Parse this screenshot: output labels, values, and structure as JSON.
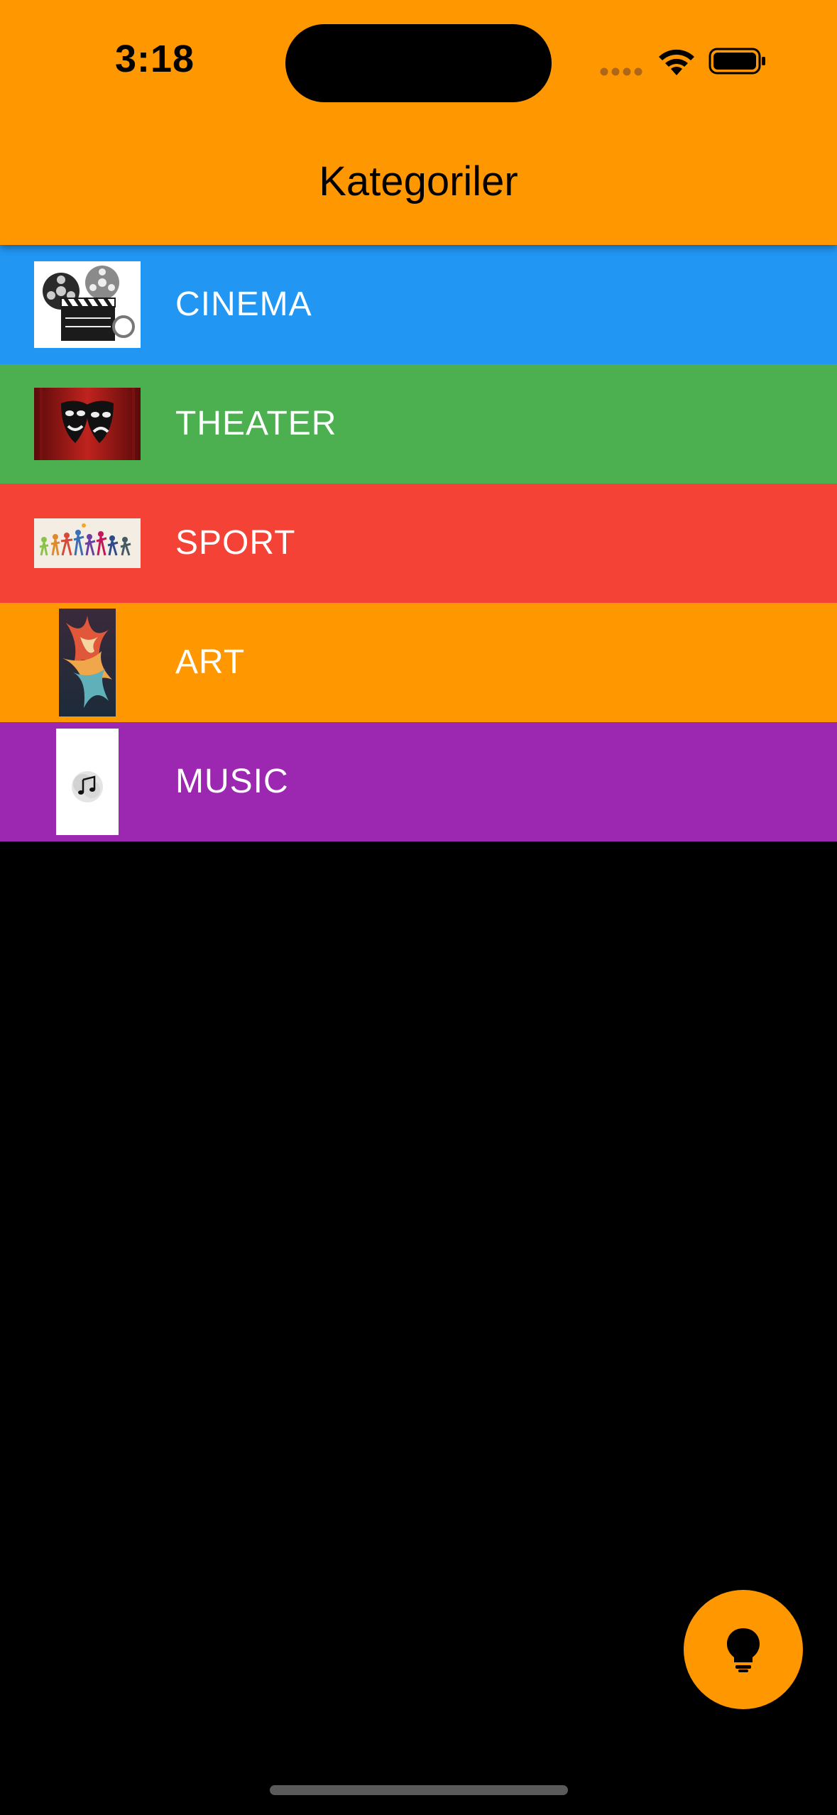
{
  "status_bar": {
    "time": "3:18"
  },
  "app_bar": {
    "title": "Kategoriler",
    "color": "#FF9800"
  },
  "categories": [
    {
      "label": "CINEMA",
      "color": "#2196F3",
      "thumbnail": "film-reel-clapperboard-image"
    },
    {
      "label": "THEATER",
      "color": "#4CAF50",
      "thumbnail": "theater-masks-image"
    },
    {
      "label": "SPORT",
      "color": "#F44336",
      "thumbnail": "sport-silhouettes-image"
    },
    {
      "label": "ART",
      "color": "#FF9800",
      "thumbnail": "abstract-paint-image"
    },
    {
      "label": "MUSIC",
      "color": "#9C27B0",
      "thumbnail": "music-note-image"
    }
  ],
  "fab": {
    "icon": "lightbulb-icon",
    "color": "#FF9800"
  },
  "background_color": "#000000"
}
